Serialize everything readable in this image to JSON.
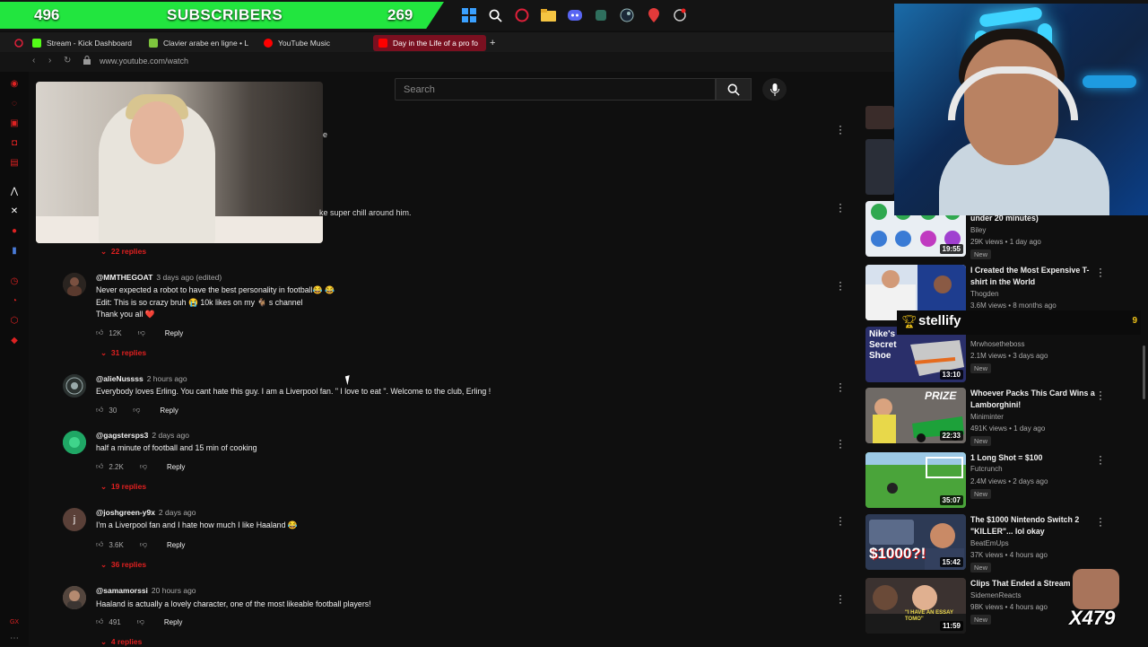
{
  "overlay": {
    "subs_left": "496",
    "subs_label": "SUBSCRIBERS",
    "subs_right": "269"
  },
  "tabs": [
    {
      "label": "Stream - Kick Dashboard",
      "color": "#53fc18"
    },
    {
      "label": "Clavier arabe en ligne • L",
      "color": "#7ec53e"
    },
    {
      "label": "YouTube Music",
      "color": "#ff0000"
    },
    {
      "label": "Day in the Life of a pro fo",
      "color": "#ff0000"
    }
  ],
  "address": {
    "url": "www.youtube.com/watch"
  },
  "search": {
    "placeholder": "Search"
  },
  "miniplayer": {
    "partial_text_1": "e",
    "partial_text_2": "ke super chill around him."
  },
  "comments": [
    {
      "replies_only": "22 replies"
    },
    {
      "handle": "@MMTHEGOAT",
      "time": "3 days ago (edited)",
      "lines": [
        "Never expected a robot to have the best personality in football😂 😂",
        "Edit: This is so crazy bruh 😭 10k likes on my 🐐 s channel",
        "Thank you all ❤️"
      ],
      "likes": "12K",
      "reply": "Reply",
      "replies": "31 replies"
    },
    {
      "handle": "@alieNussss",
      "time": "2 hours ago",
      "lines": [
        "Everybody loves Erling. You cant hate this guy. I am a Liverpool fan. \" I love to eat \". Welcome to the club, Erling !"
      ],
      "likes": "30",
      "reply": "Reply"
    },
    {
      "handle": "@gagstersps3",
      "time": "2 days ago",
      "lines": [
        "half a minute of football and 15 min of cooking"
      ],
      "likes": "2.2K",
      "reply": "Reply",
      "replies": "19 replies"
    },
    {
      "handle": "@joshgreen-y9x",
      "time": "2 days ago",
      "avatar_letter": "j",
      "lines": [
        "I'm a Liverpool fan and I hate how much I like Haaland 😂"
      ],
      "likes": "3.6K",
      "reply": "Reply",
      "replies": "36 replies"
    },
    {
      "handle": "@samamorssi",
      "time": "20 hours ago",
      "lines": [
        "Haaland is actually a lovely character, one of the most likeable football players!"
      ],
      "likes": "491",
      "reply": "Reply",
      "replies": "4 replies"
    }
  ],
  "recommended": [
    {
      "title": "under 20 minutes)",
      "channel": "Biley",
      "meta": "29K views • 1 day ago",
      "badge": "New",
      "duration": "19:55"
    },
    {
      "title": "I Created the Most Expensive T-shirt in the World",
      "channel": "Thogden",
      "meta": "3.6M views • 8 months ago",
      "badge": "",
      "duration": ""
    },
    {
      "title": "",
      "channel": "Mrwhosetheboss",
      "meta": "2.1M views • 3 days ago",
      "badge": "New",
      "duration": "13:10",
      "thumb_text": "Nike's Secret Shoe"
    },
    {
      "title": "Whoever Packs This Card Wins a Lamborghini!",
      "channel": "Miniminter",
      "meta": "491K views • 1 day ago",
      "badge": "New",
      "duration": "22:33",
      "thumb_text": "PRIZE"
    },
    {
      "title": "1 Long Shot = $100",
      "channel": "Futcrunch",
      "meta": "2.4M views • 2 days ago",
      "badge": "New",
      "duration": "35:07"
    },
    {
      "title": "The $1000 Nintendo Switch 2 \"KILLER\"... lol okay",
      "channel": "BeatEmUps",
      "meta": "37K views • 4 hours ago",
      "badge": "New",
      "duration": "15:42",
      "thumb_text": "$1000?!"
    },
    {
      "title": "Clips That Ended a Stream",
      "channel": "SidemenReacts",
      "meta": "98K views • 4 hours ago",
      "badge": "New",
      "duration": "11:59",
      "thumb_text": "\"I HAVE AN ESSAY TOMO\""
    }
  ],
  "stellify": {
    "name": "stellify",
    "count": "9"
  },
  "emote": {
    "label": "X479"
  },
  "colors": {
    "accent_red": "#e02020",
    "subs_green": "#22e53f",
    "active_tab": "#7a1020"
  }
}
